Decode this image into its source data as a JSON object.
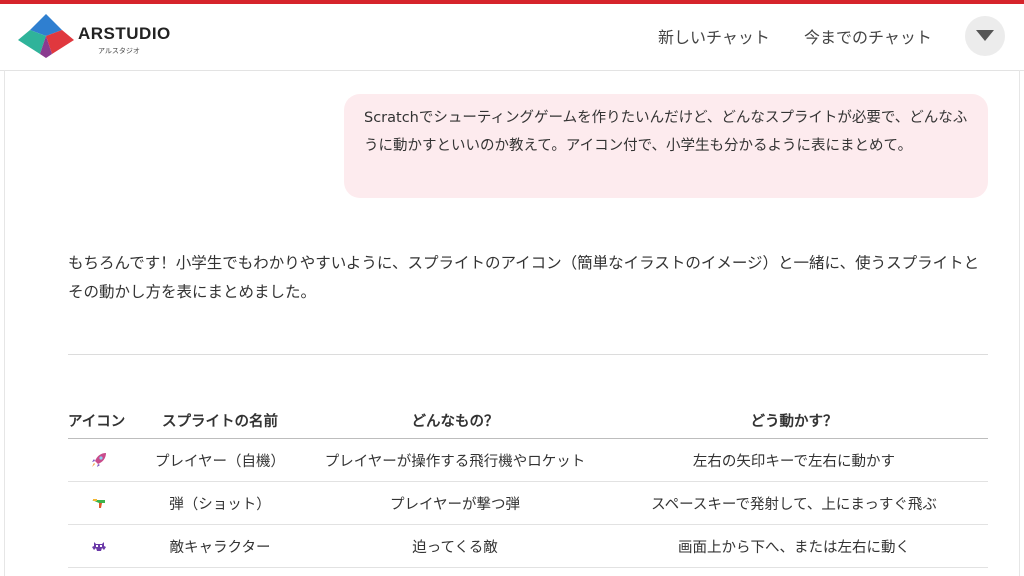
{
  "header": {
    "logo_text": "ARSTUDIO",
    "logo_sub": "アルスタジオ",
    "nav_new_chat": "新しいチャット",
    "nav_history": "今までのチャット",
    "menu_icon": "caret-down-icon",
    "accent_color": "#d6242b"
  },
  "chat": {
    "user_message": "Scratchでシューティングゲームを作りたいんだけど、どんなスプライトが必要で、どんなふうに動かすといいのか教えて。アイコン付で、小学生も分かるように表にまとめて。",
    "assistant_message": "もちろんです！小学生でもわかりやすいように、スプライトのアイコン（簡単なイラストのイメージ）と一緒に、使うスプライトとその動かし方を表にまとめました。"
  },
  "table": {
    "headers": [
      "アイコン",
      "スプライトの名前",
      "どんなもの？",
      "どう動かす？"
    ],
    "rows": [
      {
        "icon": "rocket-icon",
        "name": "プレイヤー（自機）",
        "what": "プレイヤーが操作する飛行機やロケット",
        "how": "左右の矢印キーで左右に動かす"
      },
      {
        "icon": "water-pistol-icon",
        "name": "弾（ショット）",
        "what": "プレイヤーが撃つ弾",
        "how": "スペースキーで発射して、上にまっすぐ飛ぶ"
      },
      {
        "icon": "alien-monster-icon",
        "name": "敵キャラクター",
        "what": "迫ってくる敵",
        "how": "画面上から下へ、または左右に動く"
      }
    ]
  }
}
